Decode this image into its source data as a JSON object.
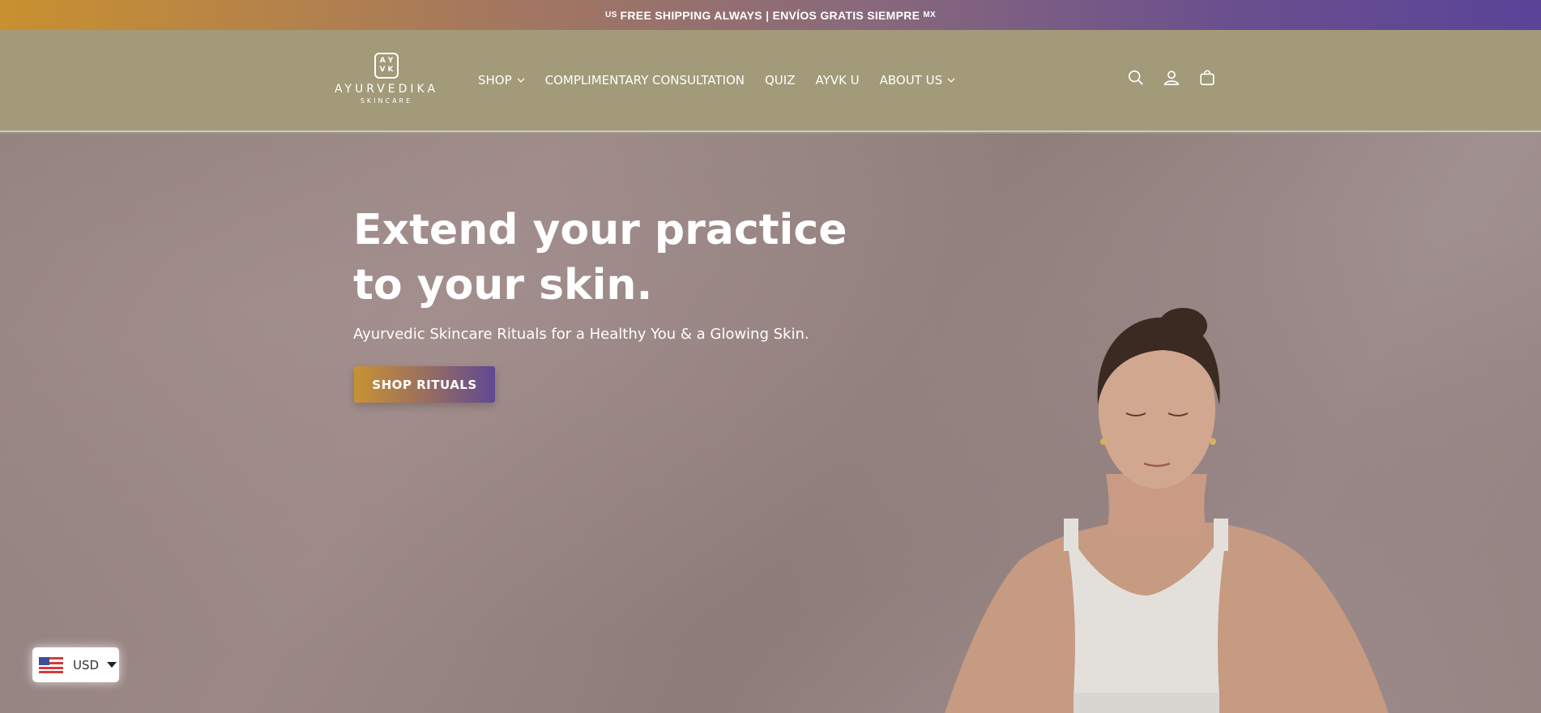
{
  "announcement": {
    "left_code": "US",
    "text": "FREE SHIPPING ALWAYS | ENVÍOS GRATIS SIEMPRE",
    "right_code": "MX"
  },
  "header": {
    "logo": {
      "mark_top": "A Y",
      "mark_bottom": "V K",
      "name": "AYURVEDIKA",
      "sub": "SKINCARE"
    },
    "nav": [
      {
        "label": "SHOP",
        "has_dropdown": true
      },
      {
        "label": "COMPLIMENTARY CONSULTATION",
        "has_dropdown": false
      },
      {
        "label": "QUIZ",
        "has_dropdown": false
      },
      {
        "label": "AYVK U",
        "has_dropdown": false
      },
      {
        "label": "ABOUT US",
        "has_dropdown": true
      }
    ],
    "icons": [
      "search-icon",
      "account-icon",
      "cart-icon"
    ]
  },
  "hero": {
    "title": "Extend your practice to your skin.",
    "subtitle": "Ayurvedic Skincare Rituals for a Healthy You & a Glowing Skin.",
    "cta": "SHOP RITUALS"
  },
  "currency": {
    "code": "USD",
    "flag": "us-flag-icon"
  },
  "colors": {
    "header_bg": "#a29a78",
    "gradient_start": "#c9902f",
    "gradient_end": "#5a4498",
    "hero_bg": "#948280"
  }
}
